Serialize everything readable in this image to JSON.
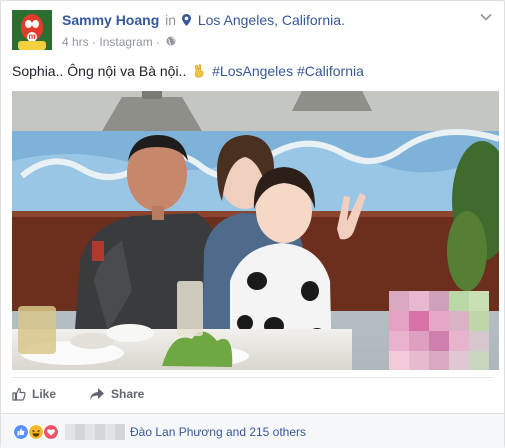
{
  "post": {
    "author": "Sammy Hoang",
    "in_word": "in",
    "location": "Los Angeles, California.",
    "time": "4 hrs",
    "separator": "·",
    "source": "Instagram",
    "separator2": "·",
    "text_before": "Sophia.. Ông nội va Bà nội..",
    "hashtag1": "#LosAngeles",
    "hashtag2": "#California"
  },
  "actions": {
    "like_label": "Like",
    "share_label": "Share"
  },
  "reactions": {
    "people_text": "Đào Lan Phương and 215 others"
  },
  "icons": {
    "location": "location-pin-icon",
    "globe": "globe-icon",
    "chevron": "chevron-down-icon",
    "victory": "victory-hand-emoji",
    "like": "thumbs-up-icon",
    "share": "share-arrow-icon",
    "reaction_like": "like-reaction-icon",
    "reaction_haha": "haha-reaction-icon",
    "reaction_love": "love-reaction-icon"
  },
  "colors": {
    "link": "#365899",
    "meta": "#90949c",
    "like_blue": "#5890ff",
    "love_red": "#f25268",
    "haha_yellow": "#f7b928"
  }
}
